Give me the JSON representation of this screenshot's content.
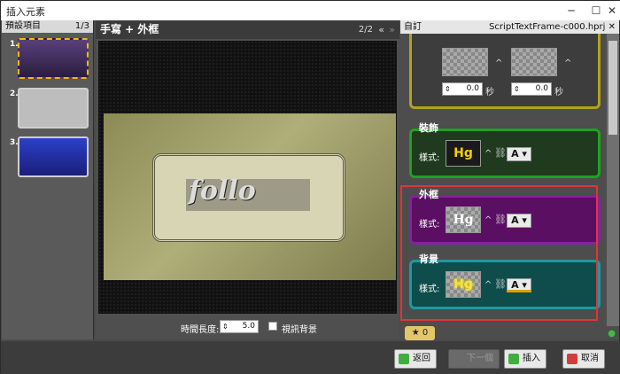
{
  "window": {
    "title": "插入元素"
  },
  "left_panel": {
    "header": "預設項目",
    "page_indicator": "1/3",
    "thumb_numbers": [
      "1.",
      "2.",
      "3."
    ]
  },
  "center": {
    "title": "手寫 + 外框",
    "page": "2/2",
    "preview_text": "follo",
    "duration_label": "時間長度:",
    "duration_value": "5.0",
    "bg_label": "視訊背景"
  },
  "right_panel": {
    "header_left": "自訂",
    "header_right": "ScriptTextFrame-c000.hprj",
    "top_values": [
      "0.0",
      "0.0"
    ],
    "sections": [
      {
        "title": "裝飾",
        "style_label": "樣式:",
        "sample": "Hg"
      },
      {
        "title": "外框",
        "style_label": "樣式:",
        "sample": "Hg"
      },
      {
        "title": "背景",
        "style_label": "樣式:",
        "sample": "Hg"
      }
    ],
    "tab_count": "0"
  },
  "buttons": {
    "back": "返回",
    "next": "下一個",
    "insert": "插入",
    "cancel": "取消"
  },
  "colors": {
    "decor_border": "#1fa21f",
    "frame_border": "#8a1fa0",
    "bg_border": "#1a9aa5",
    "highlight": "#e23535"
  }
}
